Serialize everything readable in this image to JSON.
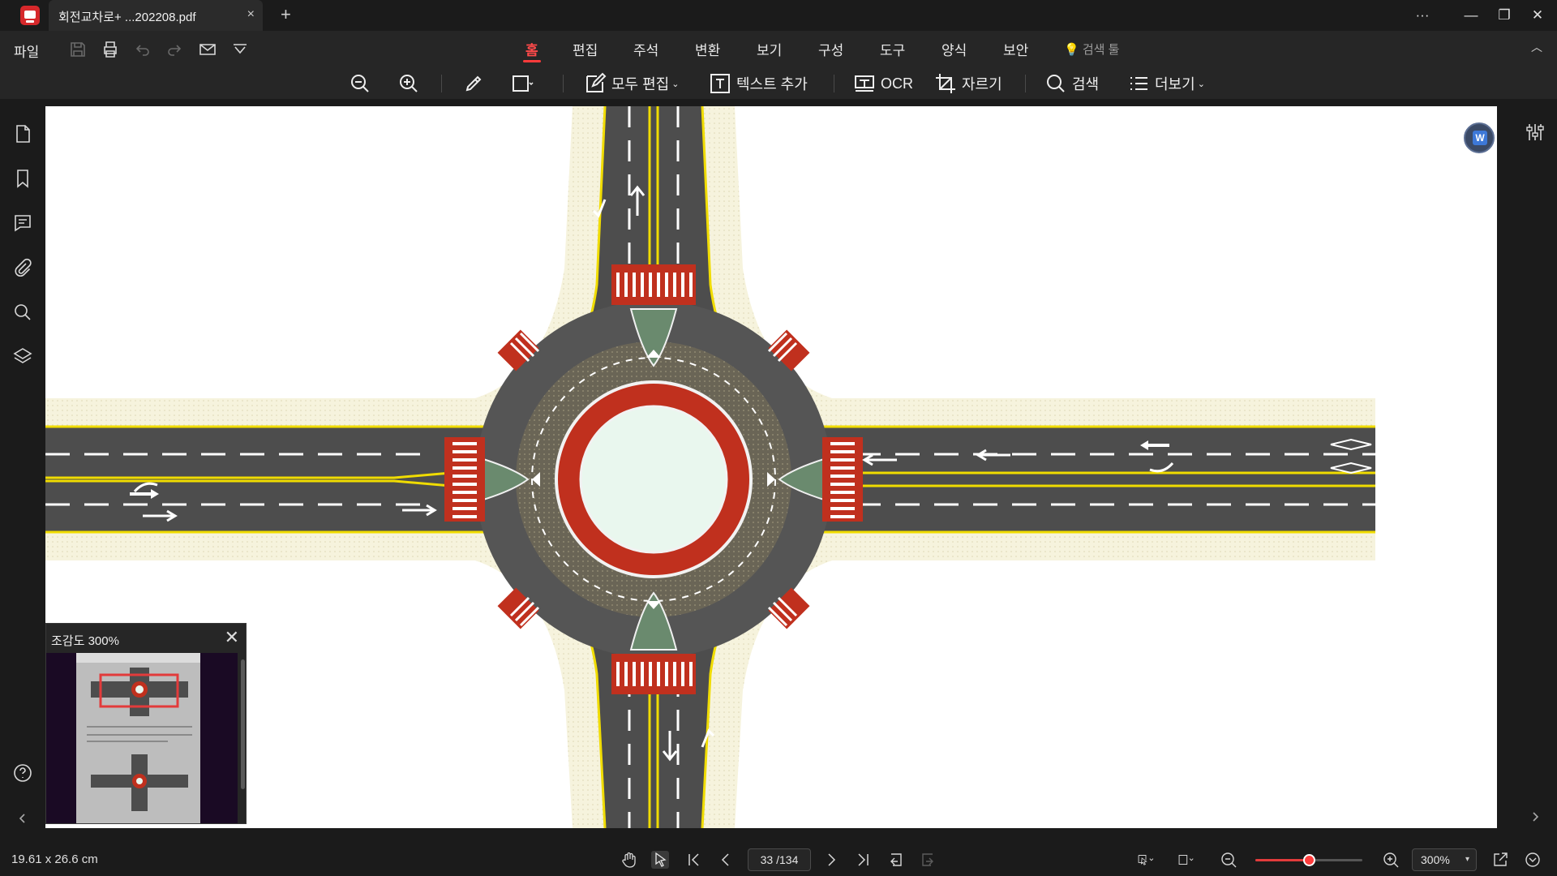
{
  "titlebar": {
    "tab_title": "회전교차로+ ...202208.pdf",
    "tab_close": "×",
    "new_tab": "+",
    "more": "···",
    "minimize": "—",
    "restore": "❐",
    "close": "✕"
  },
  "menubar": {
    "file": "파일",
    "tabs": [
      "홈",
      "편집",
      "주석",
      "변환",
      "보기",
      "구성",
      "도구",
      "양식",
      "보안"
    ],
    "active_tab": "홈",
    "search_tool": "검색 툴",
    "collapse": "︿"
  },
  "toolbar": {
    "edit_all": "모두 편집",
    "add_text": "텍스트 추가",
    "ocr": "OCR",
    "crop": "자르기",
    "search": "검색",
    "more": "더보기"
  },
  "overview": {
    "title": "조감도  300%",
    "close": "✕"
  },
  "status": {
    "page_size": "19.61 x 26.6 cm",
    "page_indicator": "33 /134",
    "zoom": "300%",
    "zoom_level": 0.5,
    "dropdown": "▾"
  },
  "word_badge": "W",
  "colors": {
    "accent": "#e23b3b",
    "asphalt": "#4d4d4d",
    "road_edge": "#f4f1da",
    "yellow_line": "#f0dc00",
    "island_red": "#c0301e",
    "island_green": "#e9f7ee",
    "splitter_green": "#6a8a6e"
  }
}
